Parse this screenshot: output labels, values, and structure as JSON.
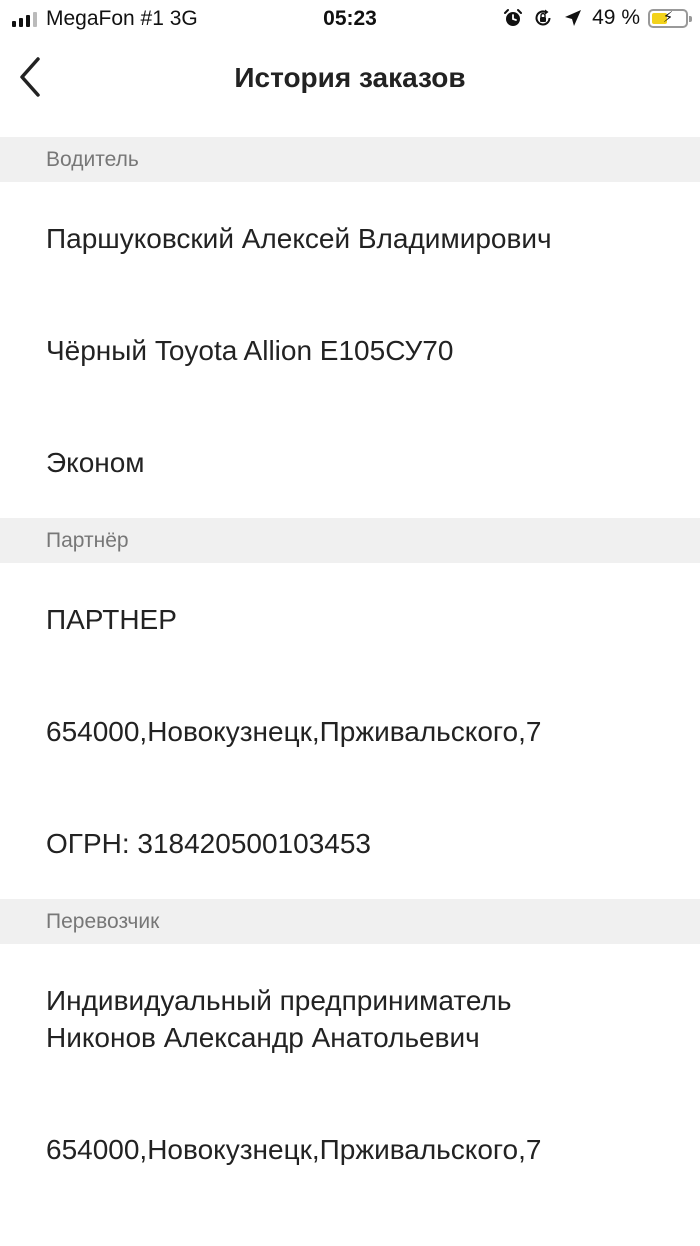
{
  "status_bar": {
    "carrier": "MegaFon #1 3G",
    "time": "05:23",
    "battery": "49 %",
    "battery_level": 0.49,
    "icons": [
      "signal-bars-icon",
      "alarm-icon",
      "rotation-lock-icon",
      "location-arrow-icon",
      "battery-charging-icon"
    ]
  },
  "nav": {
    "title": "История заказов",
    "back_icon": "chevron-left-icon"
  },
  "sections": {
    "driver": {
      "header": "Водитель",
      "name": "Паршуковский Алексей Владимирович",
      "car": "Чёрный Toyota Allion Е105СУ70",
      "tariff": "Эконом"
    },
    "partner": {
      "header": "Партнёр",
      "name": "ПАРТНЕР",
      "address": "654000,Новокузнецк,Прживальского,7",
      "ogrn": "ОГРН: 318420500103453"
    },
    "carrier": {
      "header": "Перевозчик",
      "name_line1": "Индивидуальный предприниматель",
      "name_line2": "Никонов Александр Анатольевич",
      "address": "654000,Новокузнецк,Прживальского,7"
    }
  }
}
